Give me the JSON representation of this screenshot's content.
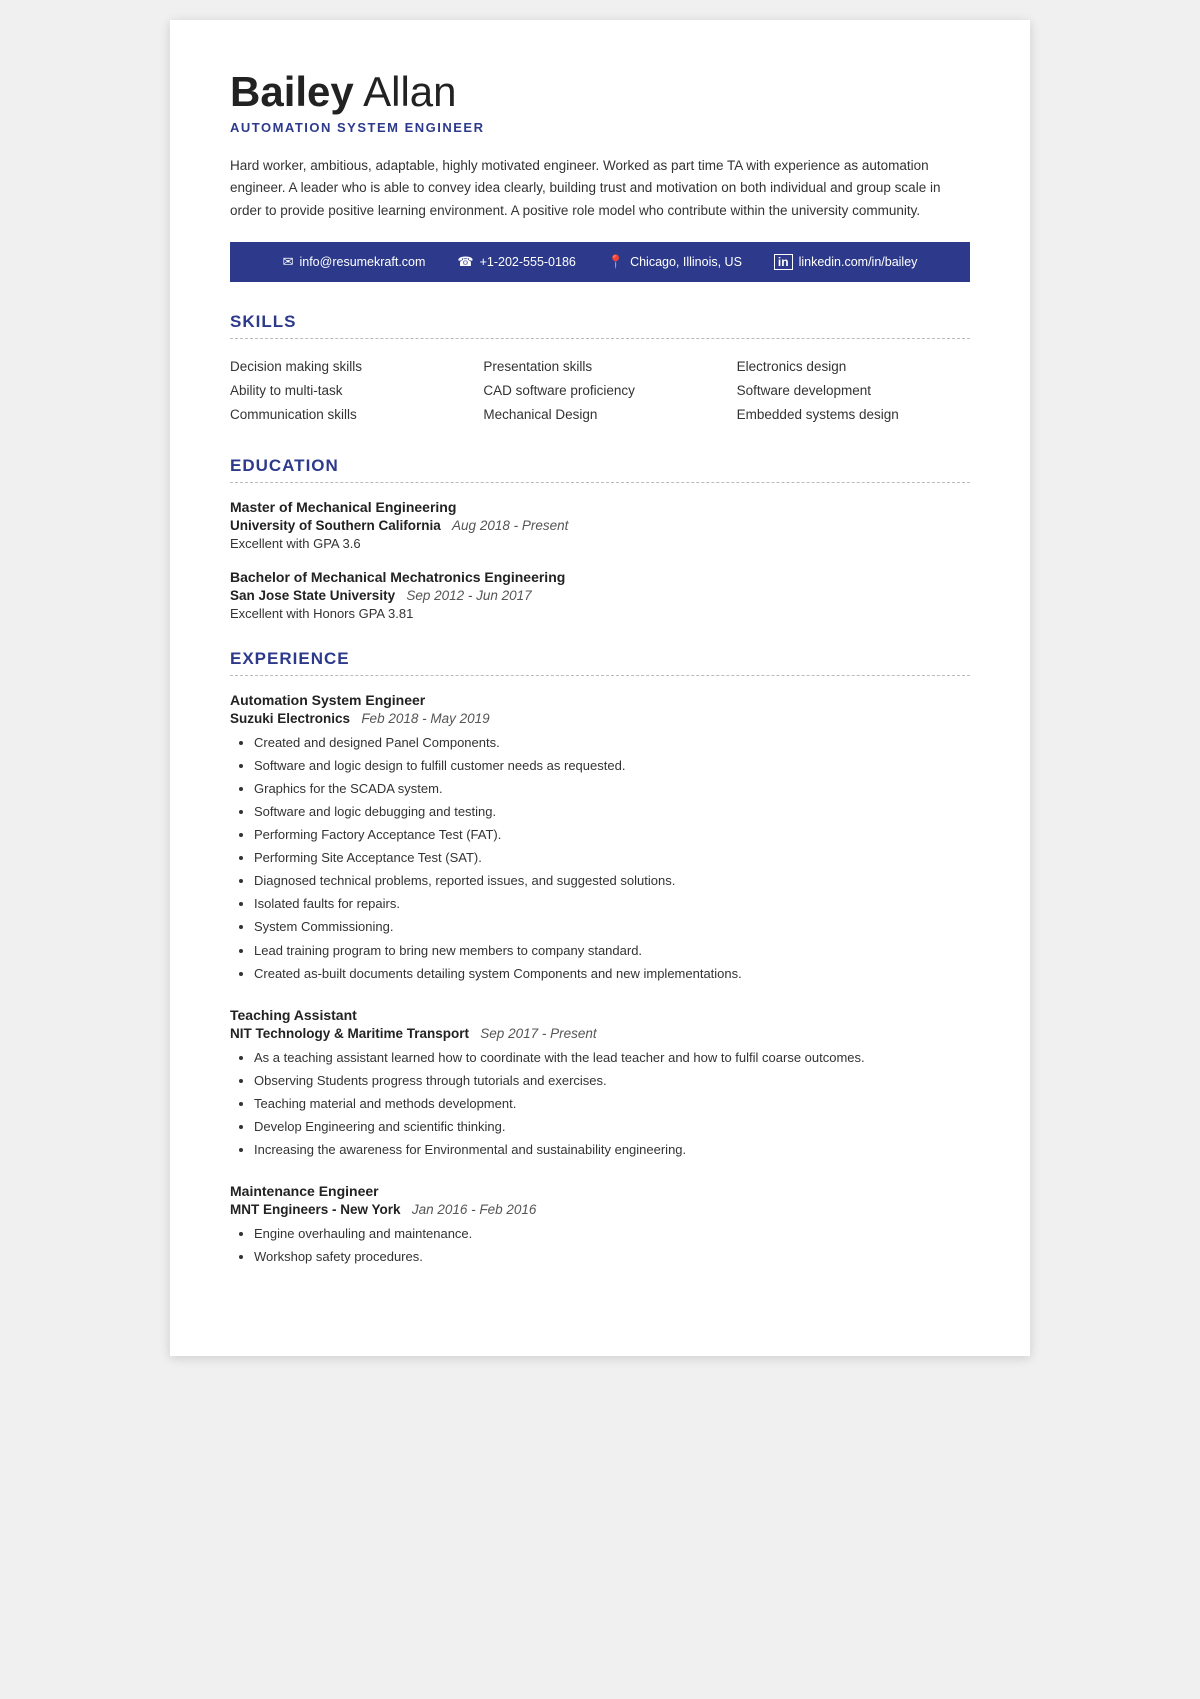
{
  "header": {
    "first_name": "Bailey",
    "last_name": "Allan",
    "title": "AUTOMATION SYSTEM ENGINEER",
    "summary": "Hard worker, ambitious, adaptable, highly motivated engineer. Worked as part time TA with experience as automation engineer. A leader who is able to convey idea clearly, building trust and motivation on both individual and group scale in order to provide positive learning environment. A positive role model who contribute within the university community."
  },
  "contact": {
    "email_icon": "✉",
    "email": "info@resumekraft.com",
    "phone_icon": "☐",
    "phone": "+1-202-555-0186",
    "location_icon": "📍",
    "location": "Chicago, Illinois, US",
    "linkedin_icon": "in",
    "linkedin": "linkedin.com/in/bailey"
  },
  "sections": {
    "skills_title": "SKILLS",
    "education_title": "EDUCATION",
    "experience_title": "EXPERIENCE"
  },
  "skills": {
    "col1": [
      "Decision making skills",
      "Ability to multi-task",
      "Communication skills"
    ],
    "col2": [
      "Presentation skills",
      "CAD software proficiency",
      "Mechanical Design"
    ],
    "col3": [
      "Electronics design",
      "Software development",
      "Embedded systems design"
    ]
  },
  "education": [
    {
      "degree": "Master of Mechanical Engineering",
      "school": "University of Southern California",
      "date": "Aug 2018 - Present",
      "gpa": "Excellent with GPA 3.6"
    },
    {
      "degree": "Bachelor of Mechanical Mechatronics Engineering",
      "school": "San Jose State University",
      "date": "Sep 2012 - Jun 2017",
      "gpa": "Excellent with Honors GPA 3.81"
    }
  ],
  "experience": [
    {
      "title": "Automation System Engineer",
      "company": "Suzuki Electronics",
      "date": "Feb 2018 - May 2019",
      "bullets": [
        "Created and designed Panel Components.",
        "Software and logic design to fulfill customer needs as requested.",
        "Graphics for the SCADA system.",
        "Software and logic debugging and testing.",
        "Performing Factory Acceptance Test (FAT).",
        "Performing Site Acceptance Test (SAT).",
        "Diagnosed technical problems, reported issues, and suggested solutions.",
        "Isolated faults for repairs.",
        "System Commissioning.",
        "Lead training program to bring new members to company standard.",
        "Created as-built documents detailing system Components and new implementations."
      ]
    },
    {
      "title": "Teaching Assistant",
      "company": "NIT Technology & Maritime Transport",
      "date": "Sep 2017 - Present",
      "bullets": [
        "As a teaching assistant learned how to coordinate with the lead teacher and how to fulfil coarse outcomes.",
        "Observing Students progress through tutorials and exercises.",
        "Teaching material and methods development.",
        "Develop Engineering and scientific thinking.",
        "Increasing the awareness for Environmental and sustainability engineering."
      ]
    },
    {
      "title": "Maintenance Engineer",
      "company": "MNT Engineers - New York",
      "date": "Jan 2016 - Feb 2016",
      "bullets": [
        "Engine overhauling and maintenance.",
        "Workshop safety procedures."
      ]
    }
  ]
}
